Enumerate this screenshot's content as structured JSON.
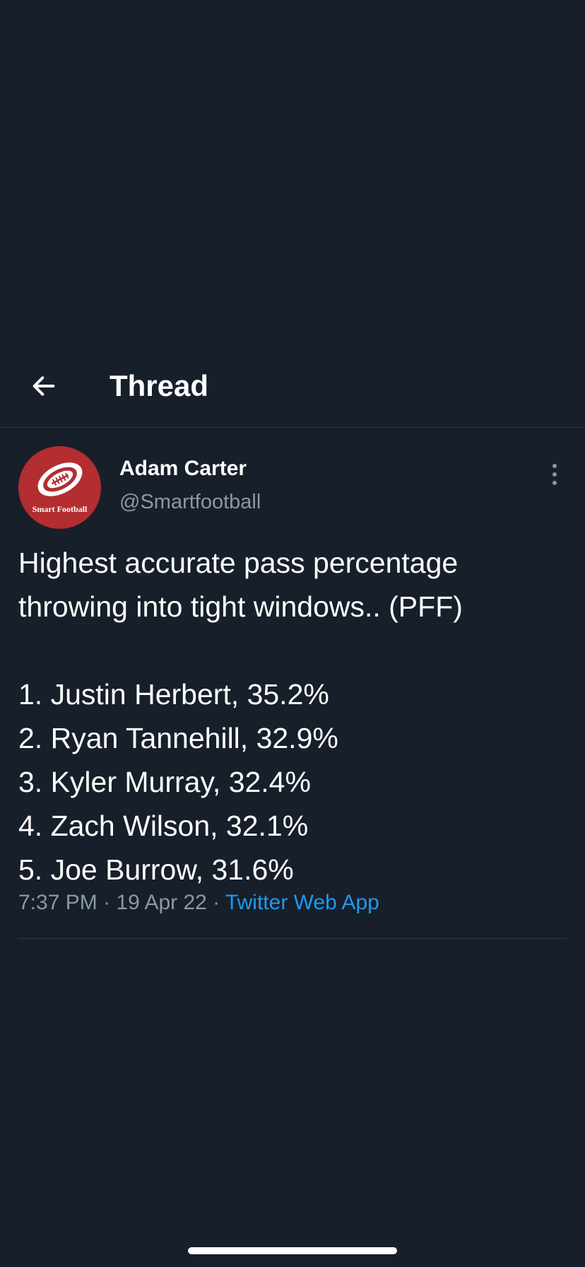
{
  "header": {
    "title": "Thread",
    "back_icon": "arrow-left-icon"
  },
  "tweet": {
    "author": {
      "name": "Adam Carter",
      "handle": "@Smartfootball",
      "avatar_text": "Smart Football",
      "avatar_color": "#b32d31"
    },
    "text_lines": [
      "Highest accurate pass percentage",
      "throwing into tight windows.. (PFF)"
    ],
    "list": [
      "1. Justin Herbert, 35.2%",
      "2. Ryan Tannehill, 32.9%",
      "3. Kyler Murray, 32.4%",
      "4. Zach Wilson, 32.1%",
      "5. Joe Burrow, 31.6%"
    ],
    "meta": {
      "time": "7:37 PM",
      "separator": " · ",
      "date": "19 Apr 22",
      "source": "Twitter Web App"
    },
    "more_icon": "more-vertical-icon"
  },
  "colors": {
    "background": "#171f2a",
    "text_primary": "#ffffff",
    "text_secondary": "#8b98a5",
    "link": "#1d9bf0",
    "divider": "#2f3a47"
  }
}
